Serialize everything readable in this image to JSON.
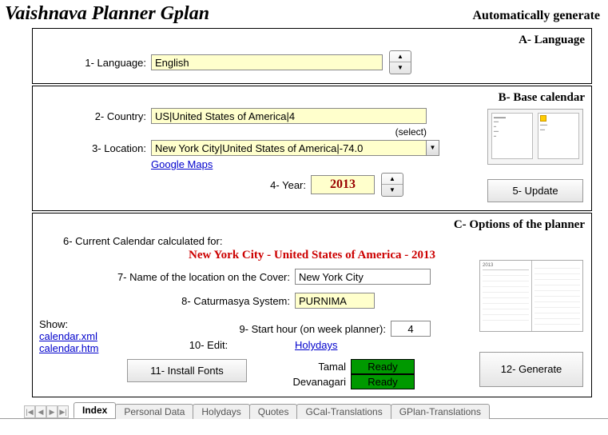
{
  "header": {
    "title": "Vaishnava Planner Gplan",
    "subtitle": "Automatically generate"
  },
  "sectionA": {
    "title": "A- Language",
    "language_label": "1- Language:",
    "language_value": "English"
  },
  "sectionB": {
    "title": "B- Base calendar",
    "country_label": "2- Country:",
    "country_value": "US|United States of America|4",
    "select_hint": "(select)",
    "location_label": "3- Location:",
    "location_value": "New York City|United States of America|-74.0",
    "maps_link": "Google Maps",
    "year_label": "4- Year:",
    "year_value": "2013",
    "update_btn": "5- Update"
  },
  "sectionC": {
    "title": "C- Options of the planner",
    "calc_label": "6- Current Calendar calculated for:",
    "calc_value": "New York City - United States of America - 2013",
    "cover_label": "7- Name of the location on the Cover:",
    "cover_value": "New York City",
    "catur_label": "8- Caturmasya System:",
    "catur_value": "PURNIMA",
    "show_label": "Show:",
    "show_xml": "calendar.xml",
    "show_htm": "calendar.htm",
    "start_label": "9- Start hour (on week planner):",
    "start_value": "4",
    "edit_label": "10- Edit:",
    "edit_link": "Holydays",
    "install_btn": "11- Install Fonts",
    "font1_label": "Tamal",
    "font1_status": "Ready",
    "font2_label": "Devanagari",
    "font2_status": "Ready",
    "generate_btn": "12- Generate"
  },
  "tabs": {
    "items": [
      "Index",
      "Personal Data",
      "Holydays",
      "Quotes",
      "GCal-Translations",
      "GPlan-Translations"
    ],
    "active": 0
  }
}
